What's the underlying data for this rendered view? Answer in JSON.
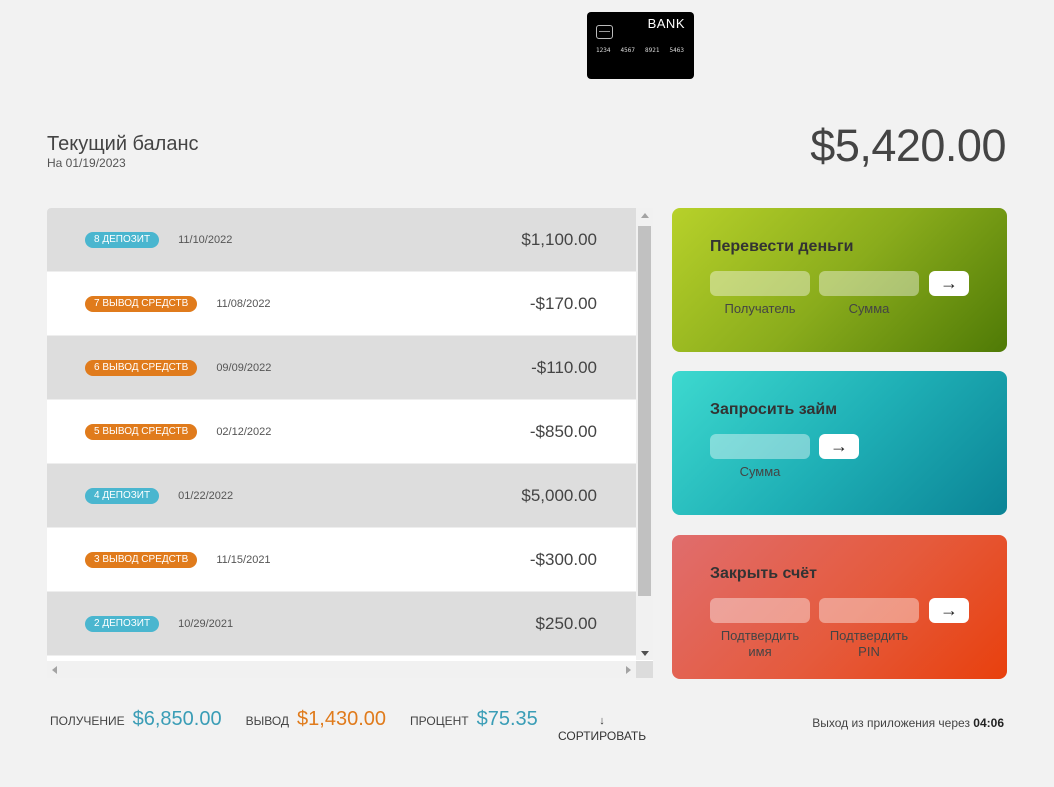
{
  "logo": {
    "bank": "BANK",
    "numbers": [
      "1234",
      "4567",
      "8921",
      "5463"
    ],
    "icon": "credit-card-icon"
  },
  "balance": {
    "title": "Текущий баланс",
    "date": "На 01/19/2023",
    "value": "$5,420.00"
  },
  "movements": [
    {
      "type": "deposit",
      "label": "8 депозит",
      "date": "11/10/2022",
      "amount": "$1,100.00"
    },
    {
      "type": "withdrawal",
      "label": "7 вывод средств",
      "date": "11/08/2022",
      "amount": "-$170.00"
    },
    {
      "type": "withdrawal",
      "label": "6 вывод средств",
      "date": "09/09/2022",
      "amount": "-$110.00"
    },
    {
      "type": "withdrawal",
      "label": "5 вывод средств",
      "date": "02/12/2022",
      "amount": "-$850.00"
    },
    {
      "type": "deposit",
      "label": "4 депозит",
      "date": "01/22/2022",
      "amount": "$5,000.00"
    },
    {
      "type": "withdrawal",
      "label": "3 вывод средств",
      "date": "11/15/2021",
      "amount": "-$300.00"
    },
    {
      "type": "deposit",
      "label": "2 депозит",
      "date": "10/29/2021",
      "amount": "$250.00"
    }
  ],
  "operations": {
    "transfer": {
      "title": "Перевести деньги",
      "to_label": "Получатель",
      "amount_label": "Сумма",
      "button": "→"
    },
    "loan": {
      "title": "Запросить займ",
      "amount_label": "Сумма",
      "button": "→"
    },
    "close": {
      "title": "Закрыть счёт",
      "user_label": "Подтвердить имя",
      "pin_label": "Подтвердить PIN",
      "button": "→"
    }
  },
  "summary": {
    "in_label": "получение",
    "in_value": "$6,850.00",
    "out_label": "вывод",
    "out_value": "$1,430.00",
    "interest_label": "процент",
    "interest_value": "$75.35",
    "sort_arrow": "↓",
    "sort_label": "СОРТИРОВАТЬ"
  },
  "logout": {
    "text": "Выход из приложения через",
    "timer": "04:06"
  },
  "colors": {
    "deposit": "#4ab6cf",
    "withdrawal": "#e07b1c",
    "transfer": "#8aac1c",
    "loan": "#1fb0b6",
    "close": "#e55a3c"
  }
}
